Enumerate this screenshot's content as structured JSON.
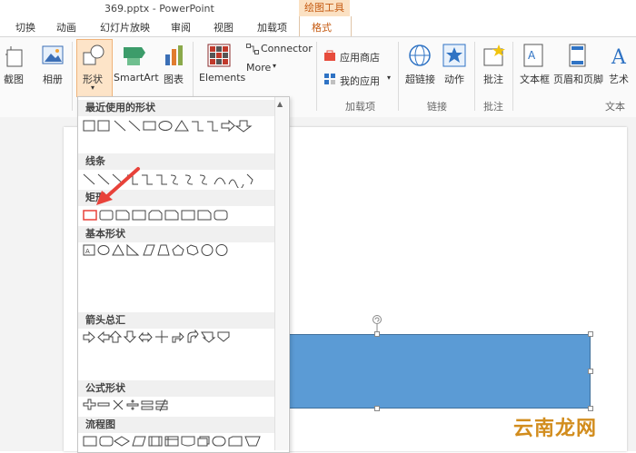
{
  "window": {
    "title": "369.pptx - PowerPoint"
  },
  "contextual": {
    "drawing_tools": "绘图工具"
  },
  "tabs": [
    "切换",
    "动画",
    "幻灯片放映",
    "审阅",
    "视图",
    "加载项",
    "格式"
  ],
  "ribbon": {
    "screenshot_partial": "截图",
    "album": "相册",
    "shapes": "形状",
    "smartart": "SmartArt",
    "chart": "图表",
    "elements": "Elements",
    "connector": "Connector",
    "more": "More",
    "app_store": "应用商店",
    "my_apps": "我的应用",
    "hyperlink": "超链接",
    "action": "动作",
    "comment": "批注",
    "textbox": "文本框",
    "header_footer": "页眉和页脚",
    "wordart_partial": "艺术",
    "group_addins": "加载项",
    "group_links": "链接",
    "group_comments": "批注",
    "group_text_partial": "文本"
  },
  "shapes_panel": {
    "sections": [
      "最近使用的形状",
      "线条",
      "矩形",
      "基本形状",
      "箭头总汇",
      "公式形状",
      "流程图"
    ]
  },
  "watermark": "云南龙网",
  "colors": {
    "accent": "#c55a11",
    "shape_fill": "#5b9bd5",
    "arrow": "#e8423a"
  }
}
